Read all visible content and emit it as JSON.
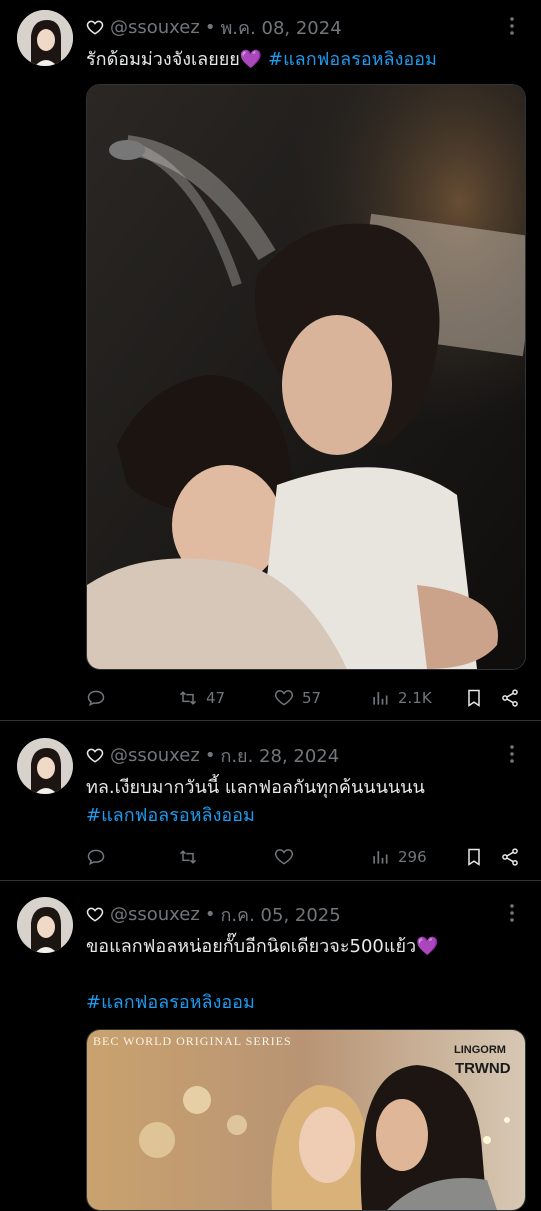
{
  "tweets": [
    {
      "handle": "@ssouxez",
      "separator": "•",
      "date": "พ.ค. 08, 2024",
      "text": "รักด้อมม่วงจังเลยยย💜",
      "hashtag": "#แลกฟอลรอหลิงออม",
      "stats": {
        "retweets": "47",
        "likes": "57",
        "views": "2.1K"
      }
    },
    {
      "handle": "@ssouxez",
      "separator": "•",
      "date": "ก.ย. 28, 2024",
      "text": "ทล.เงียบมากวันนี้ แลกฟอลกันทุกค้นนนนนน",
      "hashtag": "#แลกฟอลรอหลิงออม",
      "stats": {
        "retweets": "",
        "likes": "",
        "views": "296"
      }
    },
    {
      "handle": "@ssouxez",
      "separator": "•",
      "date": "ก.ค. 05, 2025",
      "text": "ขอแลกฟอลหน่อยกั๊บอีกนิดเดียวจะ500แย้ว💜",
      "hashtag": "#แลกฟอลรอหลิงออม",
      "media_caption": "BEC WORLD ORIGINAL SERIES",
      "media_logo_top": "LINGORM",
      "media_logo_bottom": "TRWND"
    }
  ],
  "colors": {
    "accent": "#1d9bf0",
    "muted": "#71767b",
    "bg": "#000000"
  }
}
